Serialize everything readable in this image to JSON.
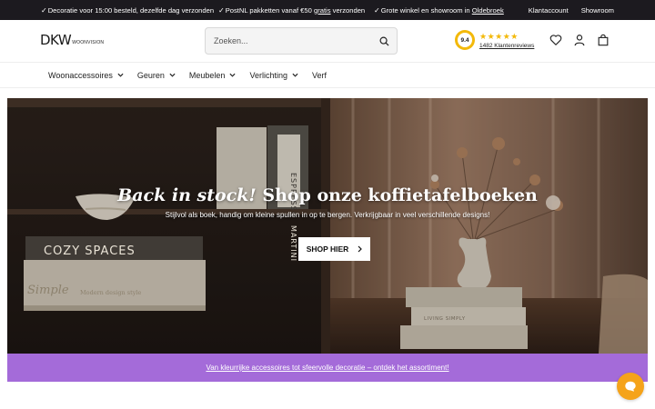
{
  "topbar": {
    "usps": [
      {
        "text": "Decoratie voor 15:00 besteld, dezelfde dag verzonden"
      },
      {
        "pre": "PostNL pakketten vanaf €50 ",
        "link": "gratis",
        "post": " verzonden"
      },
      {
        "pre": "Grote winkel en showroom in ",
        "link": "Oldebroek",
        "post": ""
      }
    ],
    "account_label": "Klantaccount",
    "showroom_label": "Showroom"
  },
  "header": {
    "logo_text": "DKW",
    "logo_sub": "WOONVISION",
    "search_placeholder": "Zoeken...",
    "rating_score": "9.4",
    "rating_stars": "★★★★★",
    "rating_reviews": "1482 Klantenreviews"
  },
  "nav": {
    "items": [
      {
        "label": "Woonaccessoires"
      },
      {
        "label": "Geuren"
      },
      {
        "label": "Meubelen"
      },
      {
        "label": "Verlichting"
      },
      {
        "label": "Verf"
      }
    ]
  },
  "hero": {
    "title_italic": "Back in stock!",
    "title_rest": " Shop onze koffietafelboeken",
    "subtitle": "Stijlvol als boek, handig om kleine spullen in op te bergen. Verkrijgbaar in veel verschillende designs!",
    "button_label": "SHOP HIER",
    "book_texts": [
      "COZY SPACES",
      "Simple",
      "Modern design style",
      "ESPRESSO",
      "MARTINI",
      "LIVING SIMPLY"
    ]
  },
  "promo": {
    "text": "Van kleurrijke accessoires tot sfeervolle decoratie – ontdek het assortiment!"
  },
  "colors": {
    "topbar_bg": "#1c1a1f",
    "promo_bg": "#a46bd9",
    "rating_accent": "#f3b90a",
    "chat_bg": "#f5a31a"
  },
  "icons": [
    "check-icon",
    "search-icon",
    "heart-icon",
    "user-icon",
    "bag-icon",
    "chevron-down-icon",
    "chevron-right-icon",
    "chat-icon"
  ]
}
